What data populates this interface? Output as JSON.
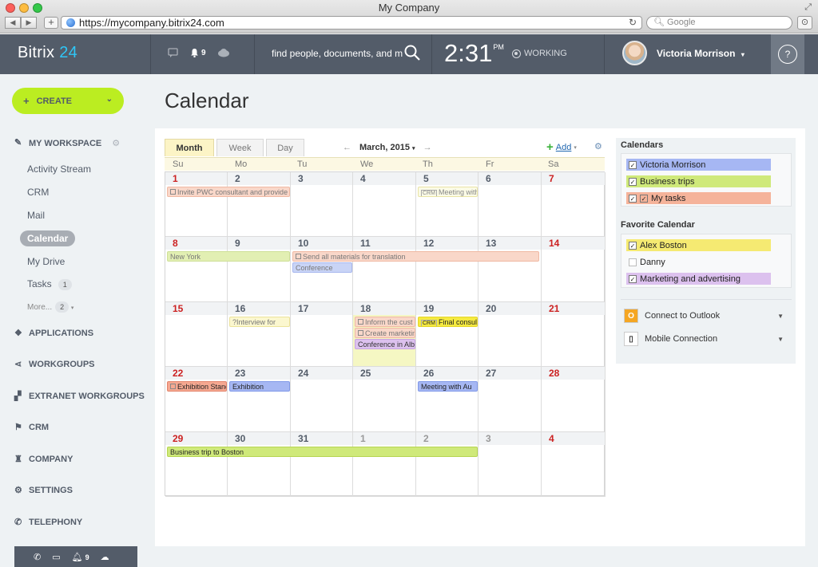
{
  "window": {
    "title": "My Company"
  },
  "browser": {
    "url": "https://mycompany.bitrix24.com",
    "search_placeholder": "Google"
  },
  "header": {
    "logo_text": "Bitrix",
    "logo_accent": "24",
    "notifications_count": "9",
    "search_placeholder": "find people, documents, and m",
    "time": "2:31",
    "ampm": "PM",
    "status": "WORKING",
    "user_name": "Victoria Morrison",
    "help": "?"
  },
  "sidebar": {
    "create_label": "CREATE",
    "workspace_label": "MY WORKSPACE",
    "items": [
      {
        "label": "Activity Stream"
      },
      {
        "label": "CRM"
      },
      {
        "label": "Mail"
      },
      {
        "label": "Calendar"
      },
      {
        "label": "My Drive"
      },
      {
        "label": "Tasks",
        "count": "1"
      },
      {
        "label": "More...",
        "count": "2"
      }
    ],
    "sections": [
      {
        "label": "APPLICATIONS"
      },
      {
        "label": "WORKGROUPS"
      },
      {
        "label": "EXTRANET WORKGROUPS"
      },
      {
        "label": "CRM"
      },
      {
        "label": "COMPANY"
      },
      {
        "label": "SETTINGS"
      },
      {
        "label": "TELEPHONY"
      }
    ],
    "bottom_notifications": "9"
  },
  "page": {
    "title": "Calendar"
  },
  "calendar": {
    "tabs": [
      "Month",
      "Week",
      "Day"
    ],
    "current": "March, 2015",
    "add_label": "Add",
    "day_names": [
      "Su",
      "Mo",
      "Tu",
      "We",
      "Th",
      "Fr",
      "Sa"
    ],
    "weeks": [
      [
        "1",
        "2",
        "3",
        "4",
        "5",
        "6",
        "7"
      ],
      [
        "8",
        "9",
        "10",
        "11",
        "12",
        "13",
        "14"
      ],
      [
        "15",
        "16",
        "17",
        "18",
        "19",
        "20",
        "21"
      ],
      [
        "22",
        "23",
        "24",
        "25",
        "26",
        "27",
        "28"
      ],
      [
        "29",
        "30",
        "31",
        "1",
        "2",
        "3",
        "4"
      ]
    ],
    "events": {
      "e1": "Invite PWC consultant and provide",
      "e2": "Meeting with J",
      "e3": "New York",
      "e4": "Send all materials for translation",
      "e5": "Conference",
      "e6": "?Interview for",
      "e7": "Inform the cust",
      "e8": "Create marketin",
      "e9": "Conference in Alba",
      "e10": "Final consultat",
      "e11": "Exhibition Stand",
      "e12": "Exhibition",
      "e13": "Meeting with Au",
      "e14": "Business trip to Boston"
    },
    "crm_tag": "CRM"
  },
  "right_panel": {
    "calendars_heading": "Calendars",
    "calendars": [
      {
        "label": "Victoria Morrison",
        "color": "#a6b7f3",
        "checked": true
      },
      {
        "label": "Business trips",
        "color": "#cfe97a",
        "checked": true
      },
      {
        "label": "My tasks",
        "color": "#f5b39a",
        "checked": true
      }
    ],
    "favorite_heading": "Favorite Calendar",
    "favorites": [
      {
        "label": "Alex Boston",
        "color": "#f5ea72",
        "checked": true
      },
      {
        "label": "Danny",
        "color": "",
        "checked": false
      },
      {
        "label": "Marketing and advertising",
        "color": "#dcc1ee",
        "checked": true
      }
    ],
    "connect_outlook": "Connect to Outlook",
    "mobile_connection": "Mobile Connection"
  },
  "colors": {
    "topbar": "#535c69",
    "create_button": "#bbed21",
    "accent_blue": "#2fc6f6",
    "sunday_red": "#cc2222"
  }
}
